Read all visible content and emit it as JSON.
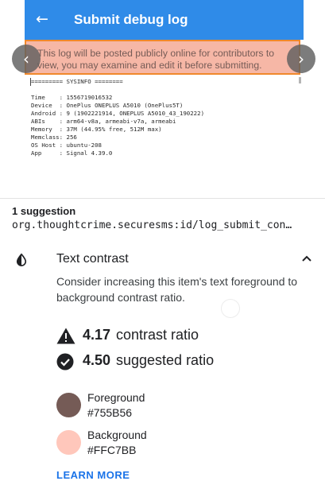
{
  "preview": {
    "app_title": "Submit debug log",
    "back_icon": "arrow-back-icon",
    "highlighted_text_line1": "This log will be posted publicly online for contributors to",
    "highlighted_text_line2": "view, you may examine and edit it before submitting.",
    "log_lines": [
      "========= SYSINFO ========",
      "",
      "Time    : 1556719016532",
      "Device  : OnePlus ONEPLUS A5010 (OnePlus5T)",
      "Android : 9 (1902221914, ONEPLUS A5010_43_190222)",
      "ABIs    : arm64-v8a, armeabi-v7a, armeabi",
      "Memory  : 37M (44.95% free, 512M max)",
      "Memclass: 256",
      "OS Host : ubuntu-208",
      "App     : Signal 4.39.0"
    ],
    "prev_icon": "chevron-left-icon",
    "next_icon": "chevron-right-icon"
  },
  "details": {
    "suggestion_count": "1 suggestion",
    "resource_id": "org.thoughtcrime.securesms:id/log_submit_con…",
    "check_title": "Text contrast",
    "check_icon": "contrast-icon",
    "collapse_icon": "chevron-up-icon",
    "description": "Consider increasing this item's text foreground to background contrast ratio.",
    "current_ratio_value": "4.17",
    "current_ratio_label": "contrast ratio",
    "suggested_ratio_value": "4.50",
    "suggested_ratio_label": "suggested ratio",
    "foreground_label": "Foreground",
    "foreground_value": "#755B56",
    "background_label": "Background",
    "background_value": "#FFC7BB",
    "learn_more": "LEARN MORE"
  },
  "colors": {
    "app_bar": "#2f8be8",
    "highlight_fill": "#f6b7a6",
    "highlight_border": "#f0892c",
    "foreground_swatch": "#755B56",
    "background_swatch": "#FFC7BB",
    "link": "#1a73e8"
  }
}
